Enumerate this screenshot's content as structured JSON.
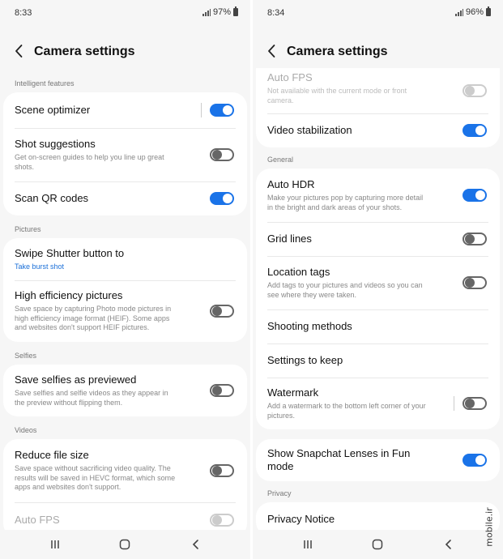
{
  "left": {
    "status": {
      "time": "8:33",
      "battery": "97%"
    },
    "title": "Camera settings",
    "sections": [
      {
        "header": "Intelligent features",
        "rows": [
          {
            "title": "Scene optimizer",
            "sub": "",
            "toggle": "on"
          },
          {
            "title": "Shot suggestions",
            "sub": "Get on-screen guides to help you line up great shots.",
            "toggle": "off"
          },
          {
            "title": "Scan QR codes",
            "sub": "",
            "toggle": "on"
          }
        ]
      },
      {
        "header": "Pictures",
        "rows": [
          {
            "title": "Swipe Shutter button to",
            "sub": "Take burst shot"
          },
          {
            "title": "High efficiency pictures",
            "sub": "Save space by capturing Photo mode pictures in high efficiency image format (HEIF). Some apps and websites don't support HEIF pictures.",
            "toggle": "off"
          }
        ]
      },
      {
        "header": "Selfies",
        "rows": [
          {
            "title": "Save selfies as previewed",
            "sub": "Save selfies and selfie videos as they appear in the preview without flipping them.",
            "toggle": "off"
          }
        ]
      },
      {
        "header": "Videos",
        "rows": [
          {
            "title": "Reduce file size",
            "sub": "Save space without sacrificing video quality. The results will be saved in HEVC format, which some apps and websites don't support.",
            "toggle": "off"
          },
          {
            "title": "Auto FPS",
            "sub": "",
            "toggle": "off"
          }
        ]
      }
    ]
  },
  "right": {
    "status": {
      "time": "8:34",
      "battery": "96%"
    },
    "title": "Camera settings",
    "card1": [
      {
        "title": "Auto FPS",
        "sub": "Not available with the current mode or front camera.",
        "toggle": "off"
      },
      {
        "title": "Video stabilization",
        "sub": "",
        "toggle": "on"
      }
    ],
    "general_header": "General",
    "card2": [
      {
        "title": "Auto HDR",
        "sub": "Make your pictures pop by capturing more detail in the bright and dark areas of your shots.",
        "toggle": "on"
      },
      {
        "title": "Grid lines",
        "sub": "",
        "toggle": "off"
      },
      {
        "title": "Location tags",
        "sub": "Add tags to your pictures and videos so you can see where they were taken.",
        "toggle": "off"
      },
      {
        "title": "Shooting methods",
        "sub": ""
      },
      {
        "title": "Settings to keep",
        "sub": ""
      },
      {
        "title": "Watermark",
        "sub": "Add a watermark to the bottom left corner of your pictures.",
        "toggle": "off"
      }
    ],
    "card3": [
      {
        "title": "Show Snapchat Lenses in Fun mode",
        "sub": "",
        "toggle": "on"
      }
    ],
    "privacy_header": "Privacy",
    "card4": [
      {
        "title": "Privacy Notice",
        "sub": ""
      }
    ]
  },
  "watermark_text": "mobile.ir",
  "colors": {
    "accent": "#1a73e8",
    "link": "#1a6fd8",
    "background": "#f6f6f6"
  }
}
